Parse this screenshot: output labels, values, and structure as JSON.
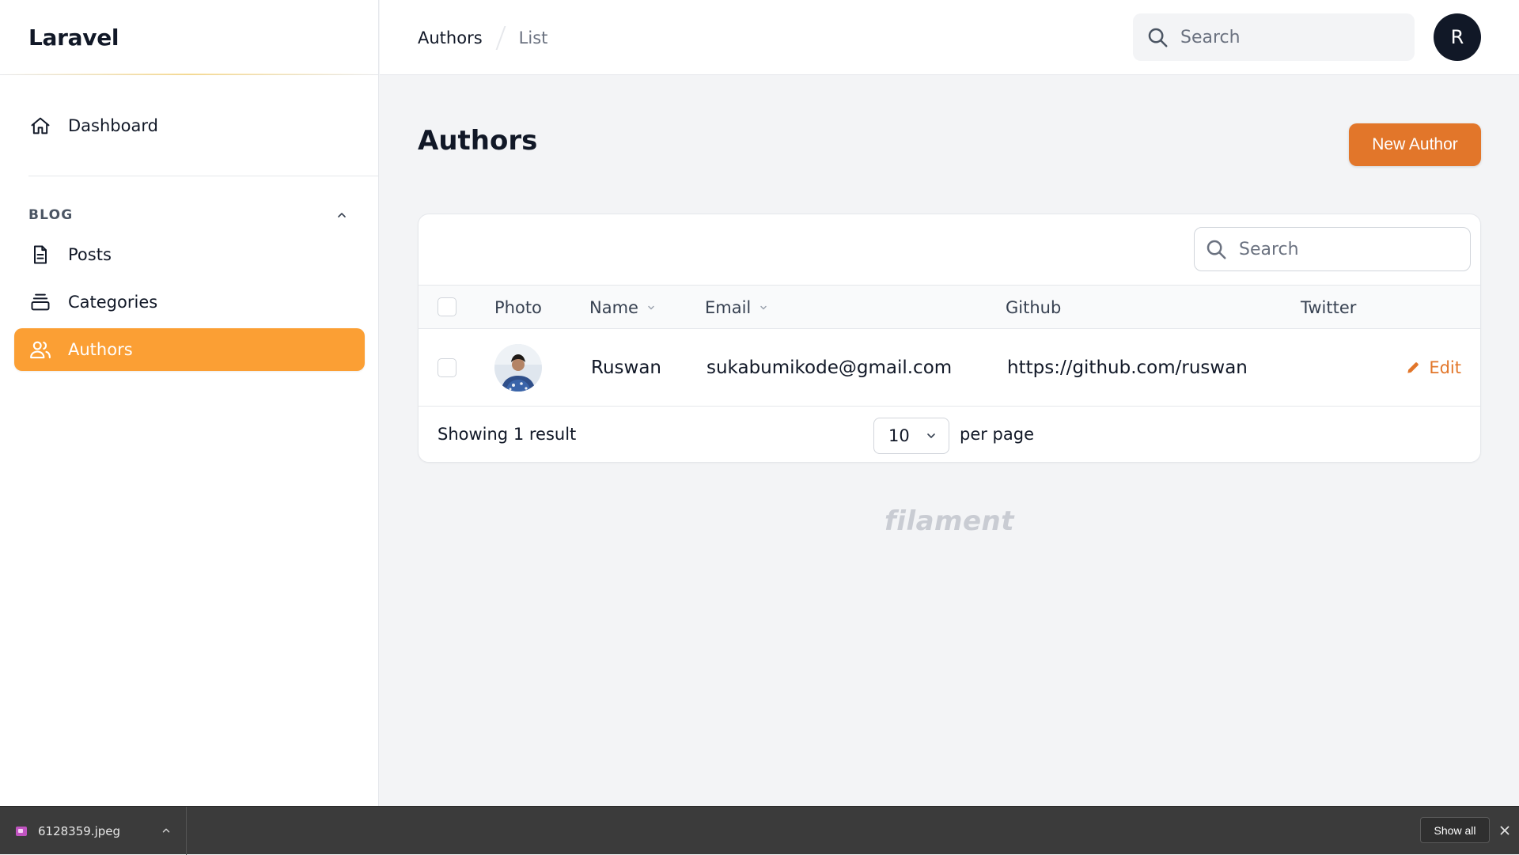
{
  "brand": {
    "name": "Laravel"
  },
  "sidebar": {
    "dashboard_label": "Dashboard",
    "group_label": "BLOG",
    "items": [
      {
        "label": "Posts",
        "icon": "document-icon"
      },
      {
        "label": "Categories",
        "icon": "collection-icon"
      },
      {
        "label": "Authors",
        "icon": "users-icon",
        "active": true
      }
    ]
  },
  "topbar": {
    "breadcrumbs": [
      "Authors",
      "List"
    ],
    "search_placeholder": "Search",
    "avatar_initial": "R"
  },
  "page": {
    "title": "Authors",
    "new_button": "New Author"
  },
  "table": {
    "search_placeholder": "Search",
    "columns": [
      "Photo",
      "Name",
      "Email",
      "Github",
      "Twitter"
    ],
    "sortable": [
      "Name",
      "Email"
    ],
    "rows": [
      {
        "name": "Ruswan",
        "email": "sukabumikode@gmail.com",
        "github": "https://github.com/ruswan",
        "twitter": "",
        "action": "Edit"
      }
    ],
    "footer": {
      "showing": "Showing 1 result",
      "per_page_value": "10",
      "per_page_label": "per page"
    }
  },
  "watermark": "filament",
  "downloads": {
    "file_name": "6128359.jpeg",
    "show_all": "Show all"
  },
  "colors": {
    "accent": "#fb9f34",
    "primary_button": "#e2762a",
    "avatar_bg": "#111827"
  }
}
